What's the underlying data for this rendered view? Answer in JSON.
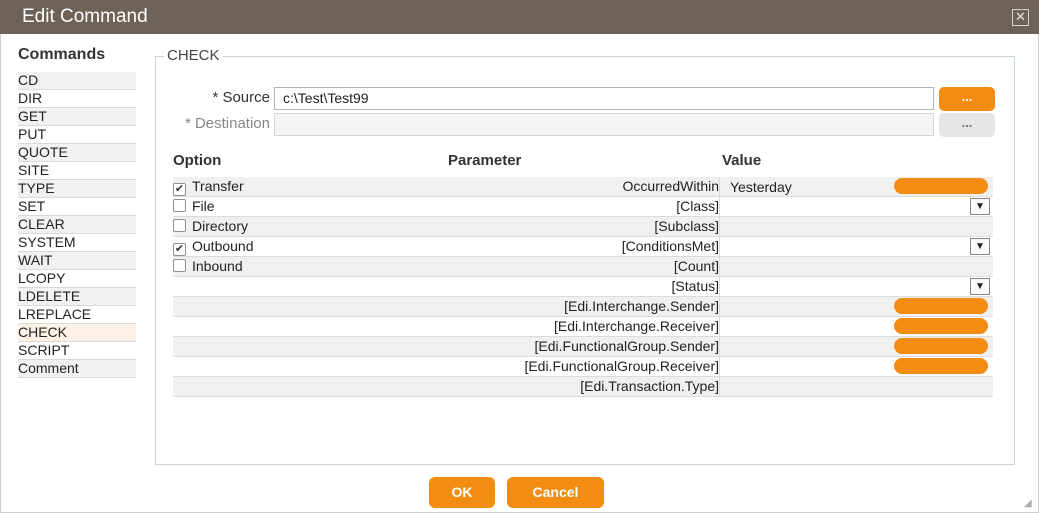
{
  "window": {
    "title": "Edit Command",
    "close_glyph": "✕"
  },
  "commands": {
    "heading": "Commands",
    "items": [
      "CD",
      "DIR",
      "GET",
      "PUT",
      "QUOTE",
      "SITE",
      "TYPE",
      "SET",
      "CLEAR",
      "SYSTEM",
      "WAIT",
      "LCOPY",
      "LDELETE",
      "LREPLACE",
      "CHECK",
      "SCRIPT",
      "Comment"
    ],
    "selected": "CHECK"
  },
  "panel": {
    "legend": "CHECK",
    "source": {
      "label": "* Source",
      "value": "c:\\Test\\Test99",
      "browse": "..."
    },
    "destination": {
      "label": "* Destination",
      "value": "",
      "browse": "..."
    }
  },
  "table": {
    "headers": {
      "option": "Option",
      "parameter": "Parameter",
      "value": "Value"
    },
    "rows": [
      {
        "option": "Transfer",
        "checked": true,
        "parameter": "OccurredWithin",
        "value": "Yesterday",
        "pill": true,
        "dropdown": false
      },
      {
        "option": "File",
        "checked": false,
        "parameter": "[Class]",
        "value": "",
        "pill": false,
        "dropdown": true
      },
      {
        "option": "Directory",
        "checked": false,
        "parameter": "[Subclass]",
        "value": "",
        "pill": false,
        "dropdown": false
      },
      {
        "option": "Outbound",
        "checked": true,
        "parameter": "[ConditionsMet]",
        "value": "",
        "pill": false,
        "dropdown": true
      },
      {
        "option": "Inbound",
        "checked": false,
        "parameter": "[Count]",
        "value": "",
        "pill": false,
        "dropdown": false
      },
      {
        "option": "",
        "checked": null,
        "parameter": "[Status]",
        "value": "",
        "pill": false,
        "dropdown": true
      },
      {
        "option": "",
        "checked": null,
        "parameter": "[Edi.Interchange.Sender]",
        "value": "",
        "pill": true,
        "dropdown": false
      },
      {
        "option": "",
        "checked": null,
        "parameter": "[Edi.Interchange.Receiver]",
        "value": "",
        "pill": true,
        "dropdown": false
      },
      {
        "option": "",
        "checked": null,
        "parameter": "[Edi.FunctionalGroup.Sender]",
        "value": "",
        "pill": true,
        "dropdown": false
      },
      {
        "option": "",
        "checked": null,
        "parameter": "[Edi.FunctionalGroup.Receiver]",
        "value": "",
        "pill": true,
        "dropdown": false
      },
      {
        "option": "",
        "checked": null,
        "parameter": "[Edi.Transaction.Type]",
        "value": "",
        "pill": false,
        "dropdown": false
      }
    ]
  },
  "footer": {
    "ok_label": "OK",
    "cancel_label": "Cancel"
  },
  "colors": {
    "accent": "#f38c12",
    "titlebar": "#6d625a"
  }
}
